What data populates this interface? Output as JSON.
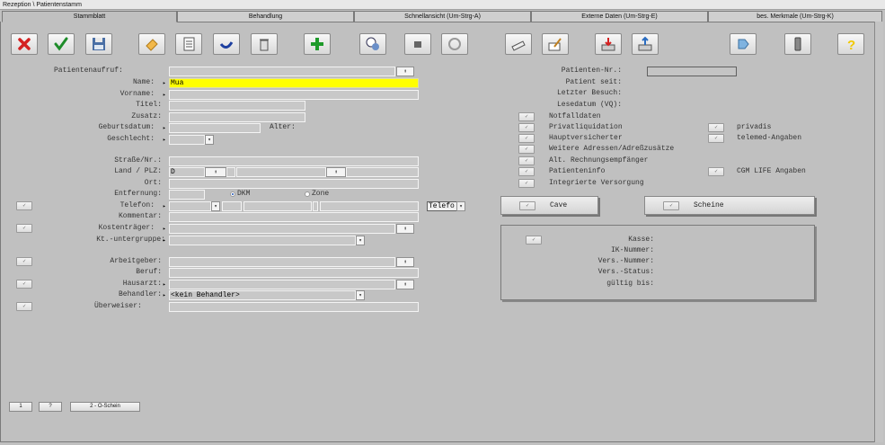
{
  "window": {
    "title": "Rezeption \\ Patientenstamm"
  },
  "tabs": [
    {
      "label": "Stammblatt"
    },
    {
      "label": "Behandlung"
    },
    {
      "label": "Schnellansicht (Um-Strg-A)"
    },
    {
      "label": "Externe Daten (Um-Strg-E)"
    },
    {
      "label": "bes. Merkmale (Um-Strg-K)"
    }
  ],
  "toolbar_icons": [
    "delete-icon",
    "confirm-icon",
    "save-icon",
    "eraser-icon",
    "notes-icon",
    "undo-icon",
    "trash-icon",
    "add-icon",
    "patient-search-icon",
    "puzzle-icon",
    "e-icon",
    "card-reader-icon",
    "edit-icon",
    "import-icon",
    "export-icon",
    "tag-icon",
    "phone-icon",
    "help-icon"
  ],
  "form": {
    "patientenaufruf": {
      "label": "Patientenaufruf:",
      "value": ""
    },
    "name": {
      "label": "Name:",
      "value": "Mua"
    },
    "vorname": {
      "label": "Vorname:",
      "value": ""
    },
    "titel": {
      "label": "Titel:",
      "value": ""
    },
    "zusatz": {
      "label": "Zusatz:",
      "value": ""
    },
    "geburtsdatum": {
      "label": "Geburtsdatum:",
      "value": ""
    },
    "alter": {
      "label": "Alter:",
      "value": ""
    },
    "geschlecht": {
      "label": "Geschlecht:",
      "value": ""
    },
    "strasse": {
      "label": "Straße/Nr.:",
      "value": ""
    },
    "land_plz": {
      "label": "Land / PLZ:",
      "land": "D",
      "plz": ""
    },
    "ort": {
      "label": "Ort:",
      "value": ""
    },
    "entfernung": {
      "label": "Entfernung:",
      "value": "",
      "radio_dkm": "DKM",
      "radio_zone": "Zone",
      "selected": "DKM"
    },
    "telefon": {
      "label": "Telefon:",
      "type_select": "Telefo"
    },
    "kommentar": {
      "label": "Kommentar:",
      "value": ""
    },
    "kostentraeger": {
      "label": "Kostenträger:",
      "value": ""
    },
    "kt_untergruppe": {
      "label": "Kt.-untergruppe:",
      "value": ""
    },
    "arbeitgeber": {
      "label": "Arbeitgeber:",
      "value": ""
    },
    "beruf": {
      "label": "Beruf:",
      "value": ""
    },
    "hausarzt": {
      "label": "Hausarzt:",
      "value": ""
    },
    "behandler": {
      "label": "Behandler:",
      "value": "<kein Behandler>"
    },
    "ueberweiser": {
      "label": "Überweiser:",
      "value": ""
    }
  },
  "right": {
    "patienten_nr": {
      "label": "Patienten-Nr.:",
      "value": ""
    },
    "patient_seit": {
      "label": "Patient seit:"
    },
    "letzter_besuch": {
      "label": "Letzter Besuch:"
    },
    "lesedatum": {
      "label": "Lesedatum (VQ):"
    },
    "options": [
      {
        "label": "Notfalldaten"
      },
      {
        "label": "Privatliquidation"
      },
      {
        "label": "Hauptversicherter"
      },
      {
        "label": "Weitere Adressen/Adreßzusätze"
      },
      {
        "label": "Alt. Rechnungsempfänger"
      },
      {
        "label": "Patienteninfo"
      },
      {
        "label": "Integrierte Versorgung"
      }
    ],
    "options2": [
      {
        "label": "privadis"
      },
      {
        "label": "telemed-Angaben"
      },
      {
        "label": "CGM LIFE Angaben"
      }
    ],
    "cave": "Cave",
    "scheine": "Scheine",
    "insurance": {
      "kasse": "Kasse:",
      "ik_nummer": "IK-Nummer:",
      "vers_nummer": "Vers.-Nummer:",
      "vers_status": "Vers.-Status:",
      "gueltig_bis": "gültig bis:"
    }
  },
  "bottom_buttons": [
    "1",
    "?",
    "2 - O-Schein"
  ],
  "colors": {
    "background": "#c0c0c0",
    "highlight": "#ffff00"
  }
}
